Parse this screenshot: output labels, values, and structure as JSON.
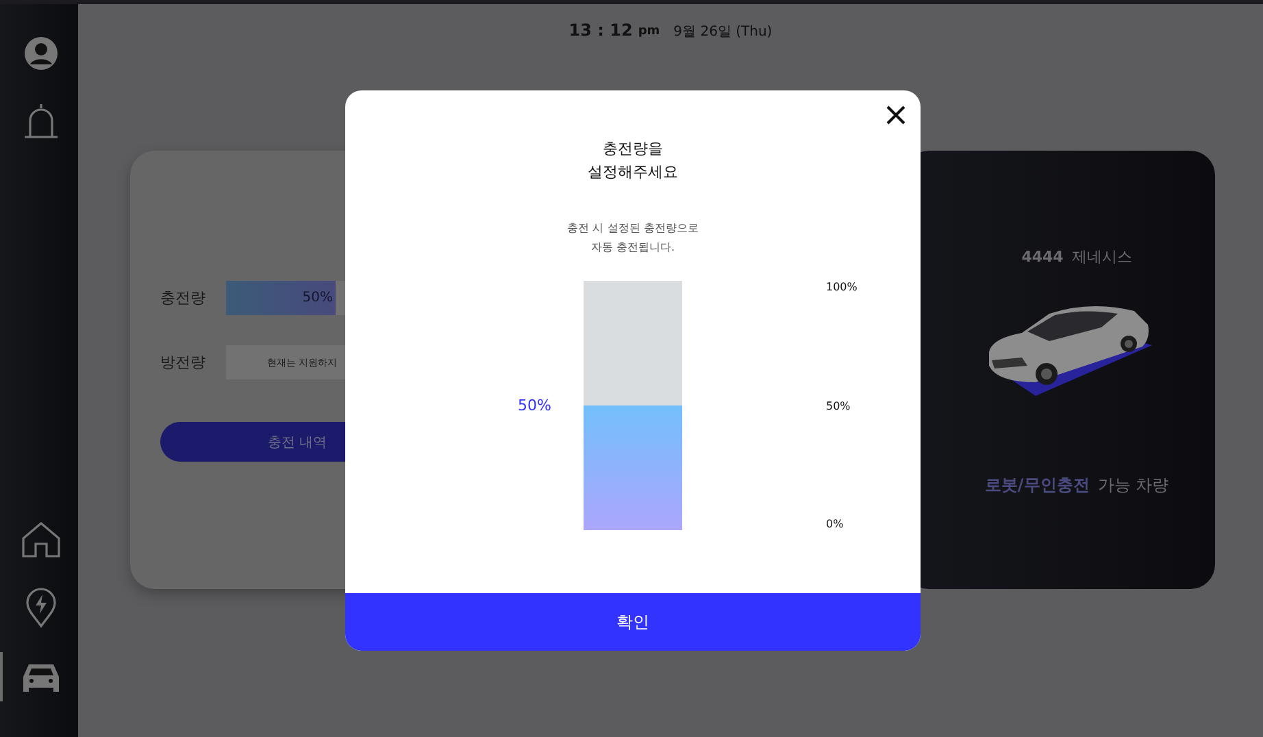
{
  "sidebar": {
    "top_items": [
      {
        "selected": false
      },
      {
        "selected": false
      }
    ],
    "bottom_items": [
      {
        "selected": false
      },
      {
        "selected": false
      },
      {
        "selected": true
      }
    ]
  },
  "header": {
    "time": "13 : 12",
    "ampm": "pm",
    "date": "9월 26일 (Thu)"
  },
  "charge_card": {
    "charge_label": "충전량",
    "level": 0.5,
    "charge_reading": "50%",
    "discharge_label": "방전량",
    "discharge_note": "현재는 지원하지",
    "history_button": "충전 내역"
  },
  "vehicle_card": {
    "plate": "4444",
    "model": "제네시스",
    "feature": "로봇/무인충전",
    "feature_suffix": "가능 차량"
  },
  "dialog": {
    "title_lines": [
      "충전량을",
      "설정해주세요"
    ],
    "subtitle_lines": [
      "충전 시 설정된 충전량으로",
      "자동 충전됩니다."
    ],
    "level": 0.5,
    "reading": "50%",
    "ticks": [
      "100%",
      "50%",
      "0%"
    ],
    "confirm": "확인"
  }
}
